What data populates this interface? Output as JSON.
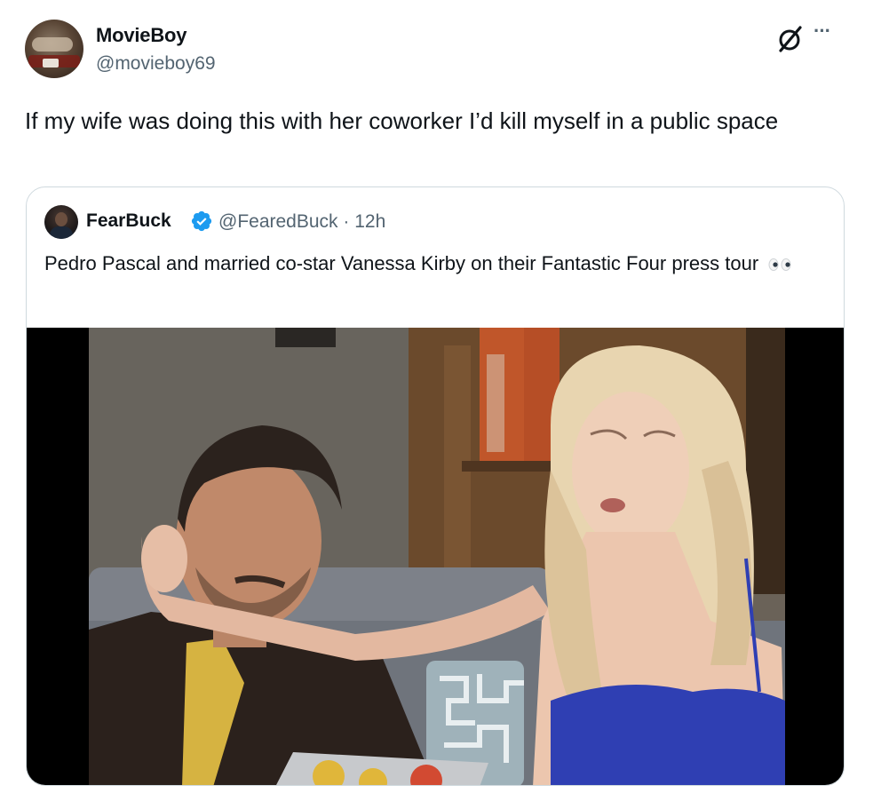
{
  "tweet": {
    "author": {
      "display_name": "MovieBoy",
      "handle": "@movieboy69"
    },
    "text": "If my wife was doing this with her coworker I’d kill myself in a public space",
    "icons": {
      "grok": "grok-icon",
      "more": "more-icon",
      "more_glyph": "···"
    }
  },
  "quoted_tweet": {
    "author": {
      "display_name": "FearBuck",
      "handle": "@FearedBuck",
      "separator": "·",
      "time": "12h",
      "verified": true
    },
    "text": "Pedro Pascal and married co-star Vanessa Kirby on their Fantastic Four press tour",
    "emoji": "eyes-emoji",
    "media": {
      "type": "video-still"
    }
  },
  "colors": {
    "text_primary": "#0f1419",
    "text_secondary": "#536471",
    "border": "#cfd9de",
    "verified_blue": "#1d9bf0"
  }
}
